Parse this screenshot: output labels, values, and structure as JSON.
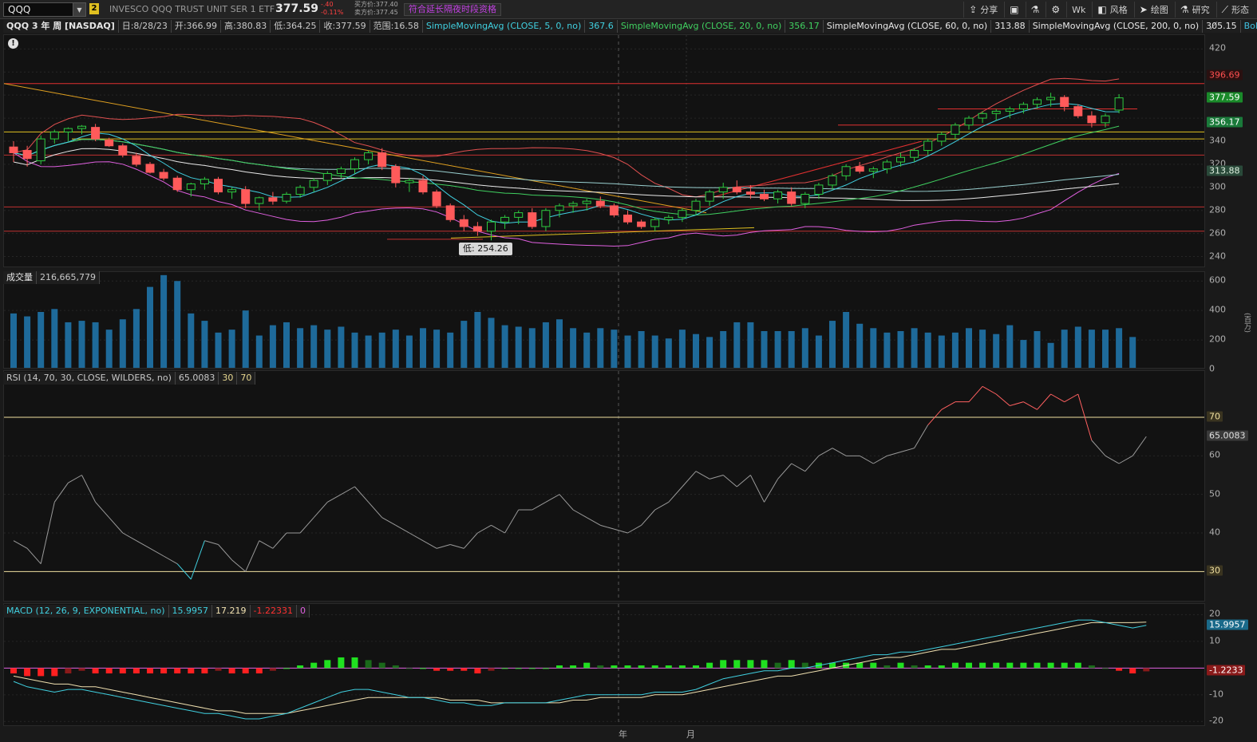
{
  "toolbar": {
    "symbol": "QQQ",
    "link_badge": "2",
    "description": "INVESCO QQQ TRUST UNIT SER 1 ETF",
    "last": "377.59",
    "change": "-.40",
    "change_pct": "-0.11%",
    "bid": "买方价:377.40",
    "ask": "卖方价:377.45",
    "extended": "符合延长隔夜时段资格",
    "tools": [
      {
        "icon": "share-icon",
        "glyph": "⇪",
        "label": "分享"
      },
      {
        "icon": "book-icon",
        "glyph": "▣",
        "label": ""
      },
      {
        "icon": "flask-icon",
        "glyph": "⚗",
        "label": ""
      },
      {
        "icon": "gear-icon",
        "glyph": "⚙",
        "label": ""
      },
      {
        "icon": "",
        "glyph": "",
        "label": "Wk"
      },
      {
        "icon": "style-icon",
        "glyph": "◧",
        "label": "风格"
      },
      {
        "icon": "cursor-icon",
        "glyph": "➤",
        "label": "绘图"
      },
      {
        "icon": "study-icon",
        "glyph": "⚗",
        "label": "研究"
      },
      {
        "icon": "pattern-icon",
        "glyph": "⟋",
        "label": "形态"
      }
    ]
  },
  "study_bar": {
    "symbol": "QQQ 3 年 周 [NASDAQ]",
    "date": "日:8/28/23",
    "open": "开:366.99",
    "high": "高:380.83",
    "low": "低:364.25",
    "close": "收:377.59",
    "range": "范围:16.58",
    "ma5_label": "SimpleMovingAvg (CLOSE, 5, 0, no)",
    "ma5_val": "367.6",
    "ma20_label": "SimpleMovingAvg (CLOSE, 20, 0, no)",
    "ma20_val": "356.17",
    "ma60_label": "SimpleMovingAvg (CLOSE, 60, 0, no)",
    "ma60_val": "313.88",
    "ma200_label": "SimpleMovingAvg (CLOSE, 200, 0, no)",
    "ma200_val": "305.15",
    "boll_label": "Bollinger..."
  },
  "price_pane": {
    "ticks": [
      "420",
      "340",
      "320",
      "300",
      "280",
      "260",
      "240"
    ],
    "tags": {
      "upper": "396.69",
      "last": "377.59",
      "ma20": "356.17",
      "ma60": "313.88"
    },
    "low_tip": "低: 254.26",
    "colors": {
      "up": "#2ecc40",
      "down": "#ff5a5a",
      "ma5": "#40d0e0",
      "ma20": "#40d060",
      "boll_up": "#e05050",
      "boll_low": "#e060e0",
      "ma200": "#e8e8e8"
    }
  },
  "volume_pane": {
    "label": "成交量",
    "value": "216,665,779",
    "ticks": [
      "600",
      "400",
      "200",
      "0"
    ],
    "unit": "(百万)"
  },
  "rsi_pane": {
    "label": "RSI (14, 70, 30, CLOSE, WILDERS, no)",
    "value": "65.0083",
    "os": "30",
    "ob": "70",
    "ticks": [
      "60",
      "50",
      "40"
    ],
    "tag_value": "65.0083"
  },
  "macd_pane": {
    "label": "MACD (12, 26, 9, EXPONENTIAL, no)",
    "value": "15.9957",
    "avg": "17.219",
    "diff": "-1.22331",
    "zero": "0",
    "ticks": [
      "20",
      "10",
      "-10",
      "-20"
    ],
    "tag_value": "15.9957",
    "tag_diff": "-1.2233"
  },
  "x_axis": {
    "year": "年",
    "month": "月"
  },
  "chart_data": {
    "type": "candlestick",
    "title": "QQQ 3 年 周 [NASDAQ]",
    "price_ohlc": [
      [
        335,
        340,
        322,
        330
      ],
      [
        332,
        336,
        318,
        325
      ],
      [
        323,
        345,
        320,
        342
      ],
      [
        342,
        350,
        338,
        348
      ],
      [
        348,
        352,
        340,
        351
      ],
      [
        351,
        354,
        346,
        353
      ],
      [
        352,
        355,
        340,
        342
      ],
      [
        341,
        343,
        335,
        336
      ],
      [
        336,
        338,
        326,
        328
      ],
      [
        327,
        330,
        318,
        320
      ],
      [
        320,
        322,
        312,
        313
      ],
      [
        313,
        316,
        306,
        308
      ],
      [
        308,
        310,
        296,
        298
      ],
      [
        298,
        304,
        292,
        303
      ],
      [
        303,
        309,
        298,
        307
      ],
      [
        307,
        309,
        294,
        296
      ],
      [
        296,
        300,
        290,
        298
      ],
      [
        298,
        301,
        282,
        286
      ],
      [
        286,
        292,
        280,
        291
      ],
      [
        291,
        296,
        285,
        288
      ],
      [
        288,
        296,
        286,
        294
      ],
      [
        294,
        302,
        291,
        300
      ],
      [
        300,
        308,
        296,
        306
      ],
      [
        306,
        314,
        302,
        312
      ],
      [
        312,
        318,
        308,
        316
      ],
      [
        316,
        326,
        312,
        324
      ],
      [
        324,
        332,
        320,
        330
      ],
      [
        330,
        334,
        315,
        318
      ],
      [
        318,
        320,
        300,
        304
      ],
      [
        304,
        308,
        296,
        306
      ],
      [
        306,
        310,
        294,
        296
      ],
      [
        296,
        298,
        282,
        284
      ],
      [
        284,
        286,
        270,
        272
      ],
      [
        272,
        276,
        262,
        266
      ],
      [
        266,
        270,
        258,
        262
      ],
      [
        262,
        272,
        254,
        270
      ],
      [
        270,
        276,
        264,
        274
      ],
      [
        274,
        280,
        268,
        278
      ],
      [
        278,
        282,
        264,
        266
      ],
      [
        266,
        282,
        262,
        280
      ],
      [
        280,
        286,
        274,
        284
      ],
      [
        284,
        288,
        278,
        286
      ],
      [
        286,
        290,
        280,
        288
      ],
      [
        288,
        292,
        282,
        284
      ],
      [
        284,
        286,
        274,
        276
      ],
      [
        276,
        280,
        268,
        270
      ],
      [
        270,
        272,
        264,
        266
      ],
      [
        266,
        274,
        262,
        272
      ],
      [
        272,
        276,
        268,
        274
      ],
      [
        274,
        282,
        270,
        280
      ],
      [
        280,
        290,
        276,
        288
      ],
      [
        288,
        298,
        284,
        296
      ],
      [
        296,
        304,
        290,
        300
      ],
      [
        300,
        306,
        294,
        296
      ],
      [
        296,
        302,
        290,
        294
      ],
      [
        294,
        298,
        288,
        290
      ],
      [
        290,
        298,
        286,
        296
      ],
      [
        296,
        300,
        284,
        286
      ],
      [
        286,
        296,
        282,
        294
      ],
      [
        294,
        304,
        290,
        302
      ],
      [
        302,
        312,
        298,
        310
      ],
      [
        310,
        320,
        306,
        318
      ],
      [
        318,
        322,
        312,
        314
      ],
      [
        314,
        318,
        308,
        316
      ],
      [
        316,
        324,
        312,
        322
      ],
      [
        322,
        330,
        318,
        326
      ],
      [
        326,
        334,
        322,
        332
      ],
      [
        332,
        342,
        328,
        340
      ],
      [
        340,
        348,
        336,
        346
      ],
      [
        346,
        356,
        342,
        354
      ],
      [
        354,
        362,
        350,
        360
      ],
      [
        360,
        366,
        356,
        364
      ],
      [
        364,
        368,
        358,
        366
      ],
      [
        366,
        370,
        360,
        368
      ],
      [
        368,
        374,
        364,
        372
      ],
      [
        372,
        378,
        368,
        376
      ],
      [
        376,
        382,
        370,
        378
      ],
      [
        378,
        380,
        366,
        370
      ],
      [
        370,
        372,
        360,
        362
      ],
      [
        362,
        366,
        352,
        356
      ],
      [
        356,
        364,
        352,
        362
      ],
      [
        366.99,
        380.83,
        364.25,
        377.59
      ]
    ],
    "volume": [
      380,
      360,
      390,
      410,
      320,
      330,
      320,
      270,
      340,
      410,
      560,
      640,
      600,
      380,
      330,
      250,
      270,
      400,
      230,
      300,
      320,
      280,
      300,
      270,
      290,
      250,
      230,
      250,
      270,
      230,
      280,
      270,
      250,
      330,
      390,
      350,
      300,
      290,
      280,
      320,
      340,
      280,
      250,
      280,
      270,
      230,
      260,
      230,
      210,
      270,
      240,
      220,
      260,
      320,
      320,
      260,
      260,
      260,
      280,
      230,
      330,
      390,
      310,
      280,
      250,
      260,
      280,
      250,
      230,
      250,
      280,
      270,
      240,
      300,
      200,
      260,
      180,
      270,
      290,
      270,
      270,
      280,
      220
    ],
    "rsi": [
      38,
      36,
      32,
      48,
      53,
      55,
      48,
      44,
      40,
      38,
      36,
      34,
      32,
      28,
      38,
      37,
      33,
      30,
      38,
      36,
      40,
      40,
      44,
      48,
      50,
      52,
      48,
      44,
      42,
      40,
      38,
      36,
      37,
      36,
      40,
      42,
      40,
      46,
      46,
      48,
      50,
      46,
      44,
      42,
      41,
      40,
      42,
      46,
      48,
      52,
      56,
      54,
      55,
      52,
      55,
      48,
      54,
      58,
      56,
      60,
      62,
      60,
      60,
      58,
      60,
      61,
      62,
      68,
      72,
      74,
      74,
      78,
      76,
      73,
      74,
      72,
      76,
      74,
      76,
      64,
      60,
      58,
      60,
      65.0083
    ],
    "macd": [
      -5,
      -7,
      -8,
      -9,
      -8,
      -8,
      -9,
      -10,
      -11,
      -12,
      -13,
      -14,
      -15,
      -16,
      -17,
      -17,
      -18,
      -19,
      -19,
      -18,
      -17,
      -15,
      -13,
      -11,
      -9,
      -8,
      -8,
      -9,
      -10,
      -11,
      -11,
      -12,
      -13,
      -13,
      -14,
      -14,
      -13,
      -13,
      -13,
      -13,
      -12,
      -11,
      -10,
      -10,
      -10,
      -10,
      -10,
      -9,
      -9,
      -9,
      -8,
      -6,
      -4,
      -3,
      -2,
      -1,
      -1,
      0,
      0,
      1,
      2,
      3,
      4,
      5,
      5,
      6,
      6,
      7,
      8,
      9,
      10,
      11,
      12,
      13,
      14,
      15,
      16,
      17,
      18,
      18,
      17,
      16,
      15,
      15.9957
    ],
    "signal": [
      -3,
      -4,
      -5,
      -6,
      -6,
      -7,
      -7,
      -8,
      -9,
      -10,
      -11,
      -12,
      -13,
      -14,
      -15,
      -16,
      -16,
      -17,
      -17,
      -17,
      -17,
      -16,
      -15,
      -14,
      -13,
      -12,
      -11,
      -11,
      -11,
      -11,
      -11,
      -11,
      -12,
      -12,
      -12,
      -13,
      -13,
      -13,
      -13,
      -13,
      -13,
      -12,
      -12,
      -11,
      -11,
      -11,
      -11,
      -10,
      -10,
      -10,
      -9,
      -8,
      -7,
      -6,
      -5,
      -4,
      -3,
      -3,
      -2,
      -1,
      0,
      1,
      2,
      3,
      4,
      4,
      5,
      6,
      7,
      7,
      8,
      9,
      10,
      11,
      12,
      13,
      14,
      15,
      16,
      17,
      17,
      17,
      17,
      17.219
    ]
  }
}
